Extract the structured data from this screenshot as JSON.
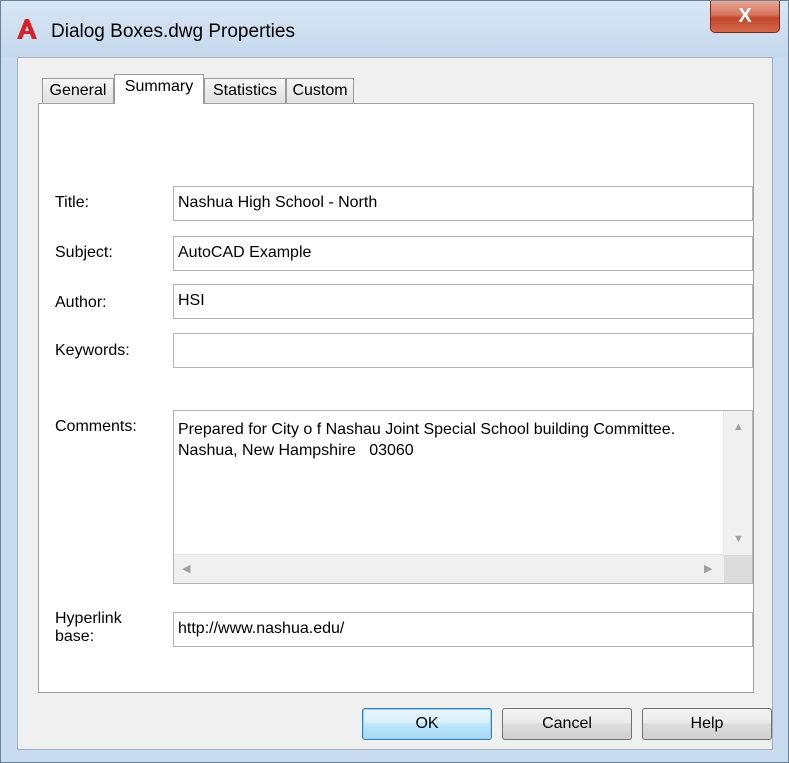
{
  "window": {
    "title": "Dialog Boxes.dwg Properties",
    "close_label": "X",
    "app_icon": "autocad-a-icon",
    "accent_color": "#c3472c"
  },
  "tabs": [
    {
      "label": "General",
      "active": false
    },
    {
      "label": "Summary",
      "active": true
    },
    {
      "label": "Statistics",
      "active": false
    },
    {
      "label": "Custom",
      "active": false
    }
  ],
  "summary": {
    "title_label": "Title:",
    "title_value": "Nashua High School - North",
    "subject_label": "Subject:",
    "subject_value": "AutoCAD Example",
    "author_label": "Author:",
    "author_value": "HSI",
    "keywords_label": "Keywords:",
    "keywords_value": "",
    "comments_label": "Comments:",
    "comments_lines": [
      "Prepared for City o f Nashau Joint Special School building Committee.",
      "Nashua, New Hampshire   03060"
    ],
    "hyperlink_label_line1": "Hyperlink",
    "hyperlink_label_line2": "base:",
    "hyperlink_value": "http://www.nashua.edu/"
  },
  "buttons": {
    "ok": "OK",
    "cancel": "Cancel",
    "help": "Help"
  }
}
